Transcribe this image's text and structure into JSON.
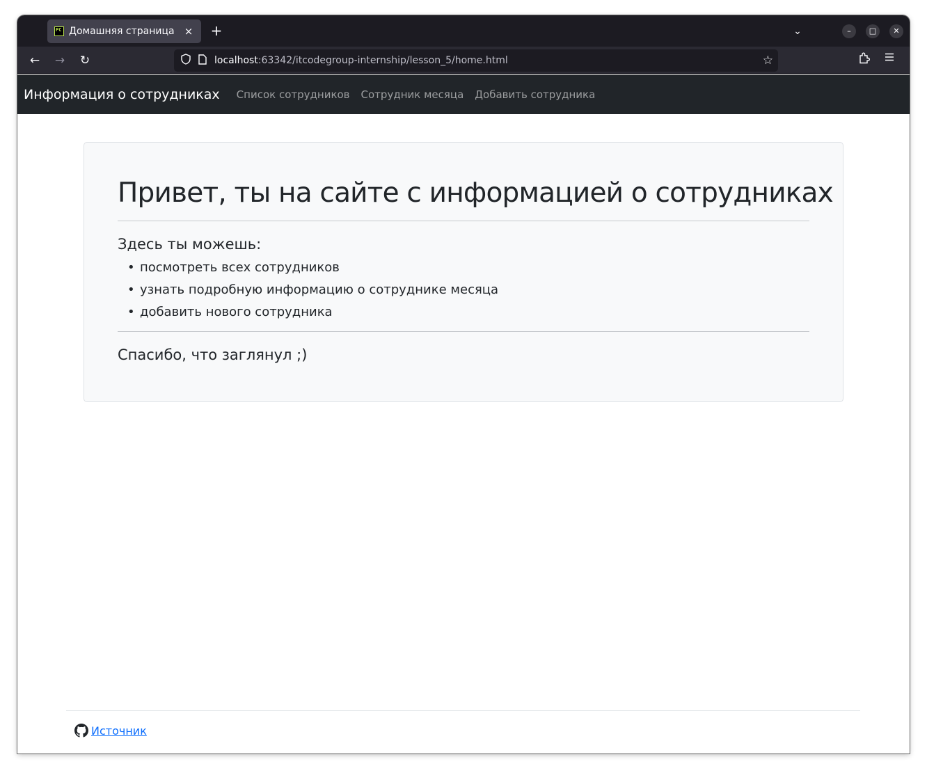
{
  "browser": {
    "tab": {
      "title": "Домашняя страница",
      "close": "×"
    },
    "new_tab": "+",
    "tabs_list": "⌄",
    "window_buttons": {
      "minimize": "–",
      "maximize": "□",
      "close": "✕"
    },
    "nav": {
      "back": "←",
      "forward": "→",
      "reload": "↻"
    },
    "url": {
      "host": "localhost",
      "rest": ":63342/itcodegroup-internship/lesson_5/home.html"
    },
    "icons": {
      "shield": "shield-icon",
      "page": "page-icon",
      "star": "star-icon",
      "extensions": "puzzle-icon",
      "menu": "hamburger-icon"
    }
  },
  "navbar": {
    "brand": "Информация о сотрудниках",
    "links": [
      "Список сотрудников",
      "Сотрудник месяца",
      "Добавить сотрудника"
    ]
  },
  "jumbotron": {
    "title": "Привет, ты на сайте с информацией о сотрудниках",
    "subtitle": "Здесь ты можешь:",
    "items": [
      "посмотреть всех сотрудников",
      "узнать подробную информацию о сотруднике месяца",
      "добавить нового сотрудника"
    ],
    "thanks": "Спасибо, что заглянул ;)"
  },
  "footer": {
    "link": "Источник",
    "icon": "github-icon"
  },
  "colors": {
    "navbar_bg": "#212529",
    "jumbotron_bg": "#f8f9fa",
    "link": "#0d6efd",
    "browser_chrome": "#1c1b22"
  }
}
